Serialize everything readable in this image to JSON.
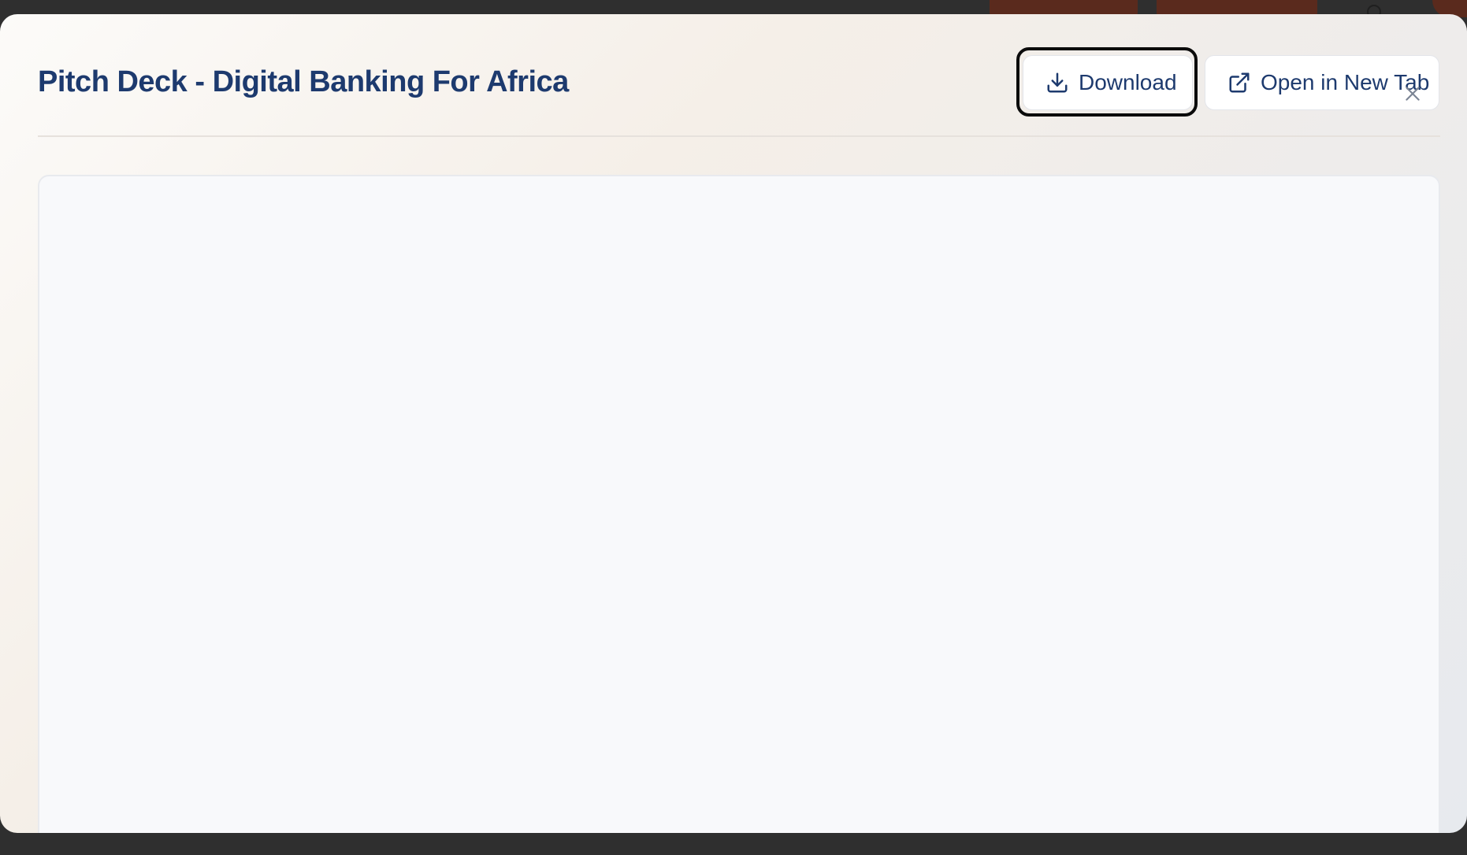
{
  "modal": {
    "title": "Pitch Deck - Digital Banking For Africa",
    "actions": {
      "download_label": "Download",
      "open_new_tab_label": "Open in New Tab"
    },
    "icons": {
      "download": "download-icon",
      "open_new_tab": "external-link-icon",
      "close": "close-icon"
    }
  },
  "colors": {
    "title": "#1d3a6e",
    "button_text": "#1d3a6e",
    "preview_bg": "#f8f9fb",
    "focus_ring": "#0b0b0b",
    "accent_blue": "#2563eb",
    "background_brand": "#5a2a1d"
  }
}
